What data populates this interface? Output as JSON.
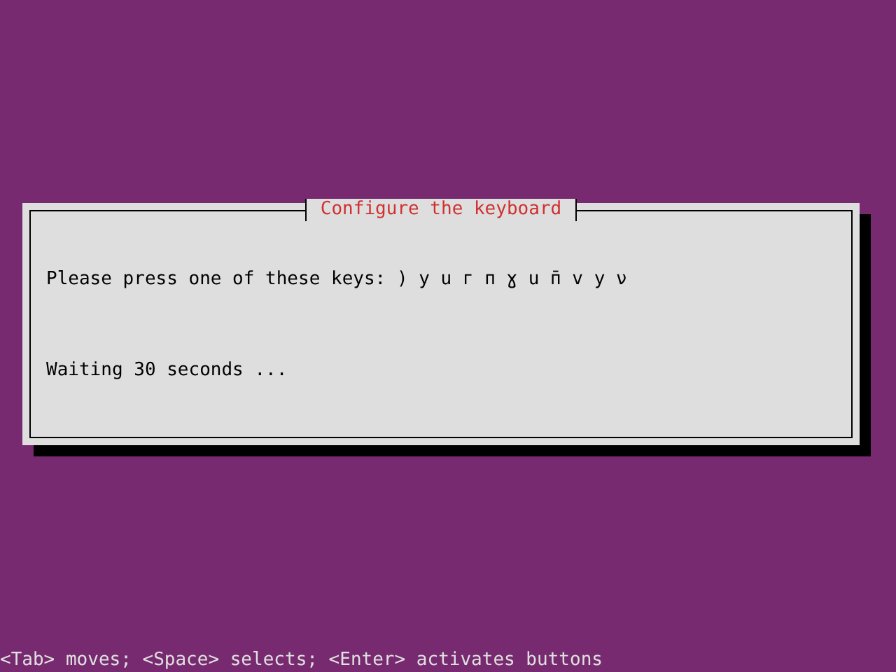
{
  "dialog": {
    "title": "Configure the keyboard",
    "prompt": "Please press one of these keys: ) y u г п ɣ u п̄ v y ν",
    "message": "Waiting 30 seconds ..."
  },
  "status_bar": "<Tab> moves; <Space> selects; <Enter> activates buttons"
}
